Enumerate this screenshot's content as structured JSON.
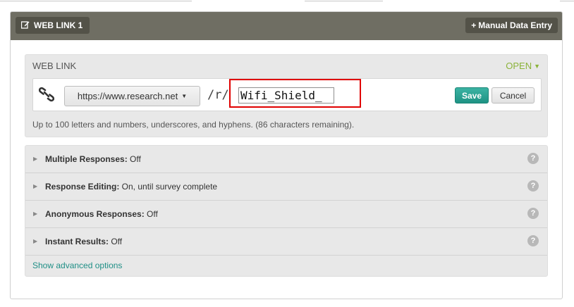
{
  "header": {
    "tab_label": "WEB LINK 1",
    "manual_entry_label": "Manual Data Entry"
  },
  "weblink": {
    "title": "WEB LINK",
    "status": "OPEN",
    "domain": "https://www.research.net",
    "path_prefix": "/r/",
    "slug_value": "Wifi_Shield_",
    "save_label": "Save",
    "cancel_label": "Cancel",
    "hint": "Up to 100 letters and numbers, underscores, and hyphens. (86 characters remaining)."
  },
  "options": [
    {
      "name": "Multiple Responses:",
      "value": " Off"
    },
    {
      "name": "Response Editing:",
      "value": " On, until survey complete"
    },
    {
      "name": "Anonymous Responses:",
      "value": " Off"
    },
    {
      "name": "Instant Results:",
      "value": " Off"
    }
  ],
  "help_glyph": "?",
  "advanced_link": "Show advanced options",
  "colors": {
    "header_bg": "#6f6e63",
    "accent_green": "#8bb33a",
    "save_teal": "#1f9384",
    "highlight_red": "#e00000",
    "link_teal": "#1f8f86"
  },
  "icons": {
    "edit": "edit-icon",
    "link": "chain-link-icon",
    "help": "help-icon",
    "expand": "triangle-right-icon"
  }
}
